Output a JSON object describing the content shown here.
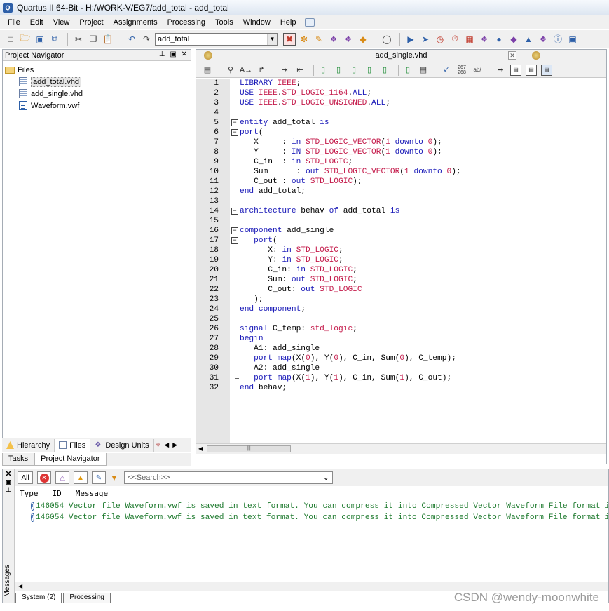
{
  "window": {
    "title": "Quartus II 64-Bit - H:/WORK-V/EG7/add_total - add_total"
  },
  "menu": [
    "File",
    "Edit",
    "View",
    "Project",
    "Assignments",
    "Processing",
    "Tools",
    "Window",
    "Help"
  ],
  "toolbar": {
    "entity_select": "add_total"
  },
  "project_navigator": {
    "title": "Project Navigator",
    "folder": "Files",
    "files": [
      "add_total.vhd",
      "add_single.vhd",
      "Waveform.vwf"
    ],
    "selected_file": "add_total.vhd",
    "tabs": [
      "Hierarchy",
      "Files",
      "Design Units"
    ],
    "active_tab": "Files",
    "bottom_tabs": [
      "Tasks",
      "Project Navigator"
    ]
  },
  "editor": {
    "tab_title": "add_single.vhd",
    "lines": [
      {
        "n": "1",
        "text": "LIBRARY IEEE;"
      },
      {
        "n": "2",
        "text": "USE IEEE.STD_LOGIC_1164.ALL;"
      },
      {
        "n": "3",
        "text": "USE IEEE.STD_LOGIC_UNSIGNED.ALL;"
      },
      {
        "n": "4",
        "text": ""
      },
      {
        "n": "5",
        "text": "entity add_total is"
      },
      {
        "n": "6",
        "text": "port("
      },
      {
        "n": "7",
        "text": "   X     : in STD_LOGIC_VECTOR(1 downto 0);"
      },
      {
        "n": "8",
        "text": "   Y     : IN STD_LOGIC_VECTOR(1 downto 0);"
      },
      {
        "n": "9",
        "text": "   C_in  : in STD_LOGIC;"
      },
      {
        "n": "10",
        "text": "   Sum      : out STD_LOGIC_VECTOR(1 downto 0);"
      },
      {
        "n": "11",
        "text": "   C_out : out STD_LOGIC);"
      },
      {
        "n": "12",
        "text": "end add_total;"
      },
      {
        "n": "13",
        "text": ""
      },
      {
        "n": "14",
        "text": "architecture behav of add_total is"
      },
      {
        "n": "15",
        "text": ""
      },
      {
        "n": "16",
        "text": "component add_single"
      },
      {
        "n": "17",
        "text": "   port("
      },
      {
        "n": "18",
        "text": "      X: in STD_LOGIC;"
      },
      {
        "n": "19",
        "text": "      Y: in STD_LOGIC;"
      },
      {
        "n": "20",
        "text": "      C_in: in STD_LOGIC;"
      },
      {
        "n": "21",
        "text": "      Sum: out STD_LOGIC;"
      },
      {
        "n": "22",
        "text": "      C_out: out STD_LOGIC"
      },
      {
        "n": "23",
        "text": "   );"
      },
      {
        "n": "24",
        "text": "end component;"
      },
      {
        "n": "25",
        "text": ""
      },
      {
        "n": "26",
        "text": "signal C_temp: std_logic;"
      },
      {
        "n": "27",
        "text": "begin"
      },
      {
        "n": "28",
        "text": "   A1: add_single"
      },
      {
        "n": "29",
        "text": "   port map(X(0), Y(0), C_in, Sum(0), C_temp);"
      },
      {
        "n": "30",
        "text": "   A2: add_single"
      },
      {
        "n": "31",
        "text": "   port map(X(1), Y(1), C_in, Sum(1), C_out);"
      },
      {
        "n": "32",
        "text": "end behav;"
      }
    ]
  },
  "messages": {
    "filter_all": "All",
    "search_placeholder": "<<Search>>",
    "columns": [
      "Type",
      "ID",
      "Message"
    ],
    "rows": [
      {
        "id": "146054",
        "text": "Vector file Waveform.vwf is saved in text format. You can compress it into Compressed Vector Waveform File format in order to reduce file size."
      },
      {
        "id": "146054",
        "text": "Vector file Waveform.vwf is saved in text format. You can compress it into Compressed Vector Waveform File format in order to reduce file size."
      }
    ],
    "side_label": "Messages",
    "tabs": [
      "System (2)",
      "Processing"
    ]
  },
  "watermark": "CSDN @wendy-moonwhite"
}
